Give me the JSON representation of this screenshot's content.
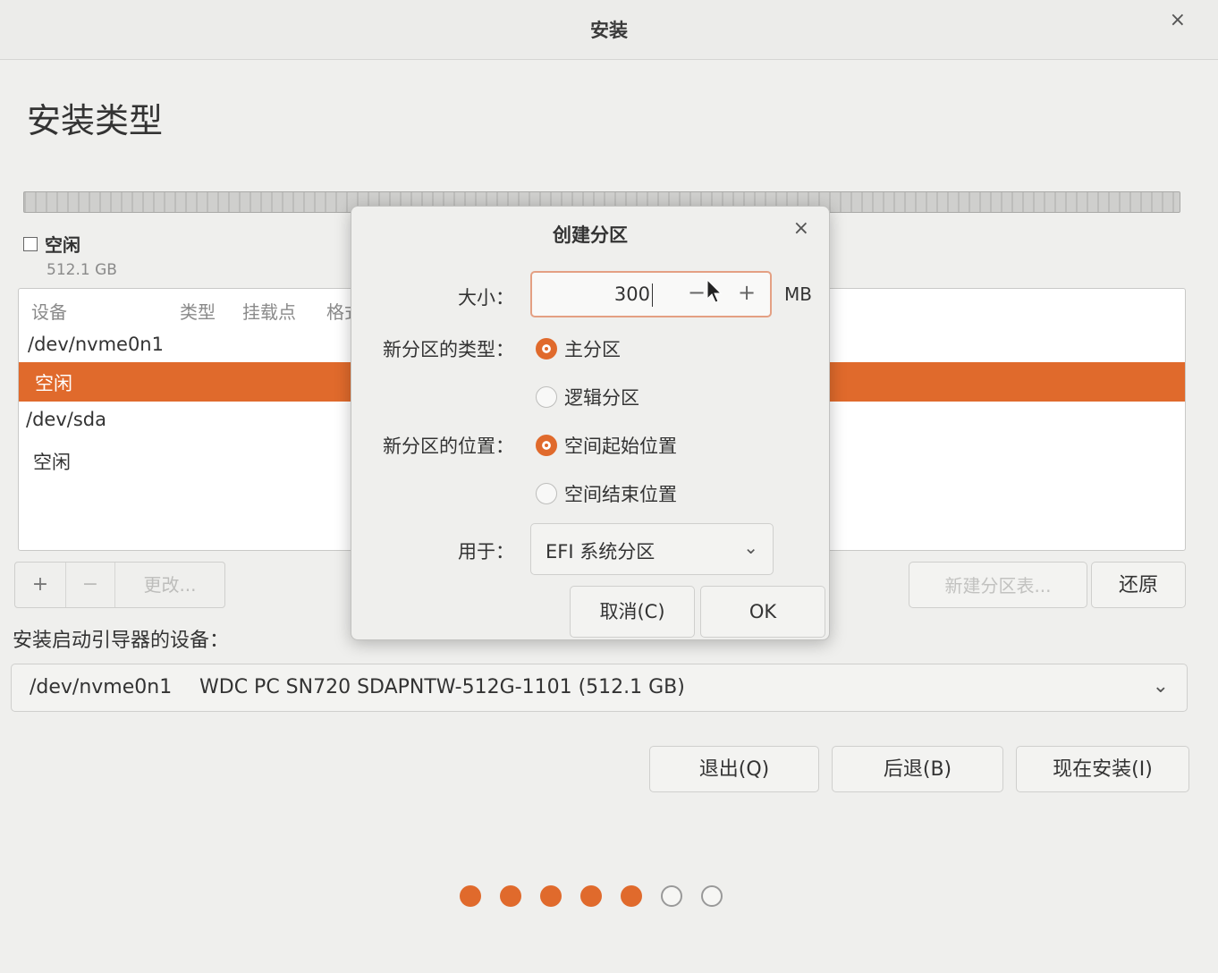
{
  "window": {
    "title": "安装",
    "close": "×"
  },
  "page": {
    "heading": "安装类型"
  },
  "legend": {
    "name": "空闲",
    "size": "512.1 GB"
  },
  "table": {
    "headers": [
      "设备",
      "类型",
      "挂载点",
      "格式"
    ],
    "rows": [
      {
        "text": "/dev/nvme0n1",
        "selected": false
      },
      {
        "text": "空闲",
        "selected": true
      },
      {
        "text": "/dev/sda",
        "selected": false
      },
      {
        "text": "空闲",
        "selected": false
      }
    ]
  },
  "partition_buttons": {
    "add": "+",
    "remove": "−",
    "change": "更改..."
  },
  "table_actions": {
    "new_table": "新建分区表...",
    "revert": "还原"
  },
  "bootloader": {
    "label": "安装启动引导器的设备：",
    "device": "/dev/nvme0n1",
    "model": "WDC PC SN720 SDAPNTW-512G-1101 (512.1 GB)",
    "chevron": "⌄"
  },
  "nav": {
    "quit": "退出(Q)",
    "back": "后退(B)",
    "install": "现在安装(I)"
  },
  "progress": {
    "total": 7,
    "completed": 5
  },
  "dialog": {
    "title": "创建分区",
    "close": "×",
    "size_label": "大小：",
    "size_value": "300",
    "size_unit": "MB",
    "minus": "−",
    "plus": "+",
    "type_label": "新分区的类型：",
    "type_options": [
      {
        "label": "主分区",
        "selected": true
      },
      {
        "label": "逻辑分区",
        "selected": false
      }
    ],
    "location_label": "新分区的位置：",
    "location_options": [
      {
        "label": "空间起始位置",
        "selected": true
      },
      {
        "label": "空间结束位置",
        "selected": false
      }
    ],
    "use_label": "用于：",
    "use_value": "EFI 系统分区",
    "use_chevron": "⌄",
    "cancel": "取消(C)",
    "ok": "OK"
  },
  "colors": {
    "accent": "#e06a2c"
  }
}
